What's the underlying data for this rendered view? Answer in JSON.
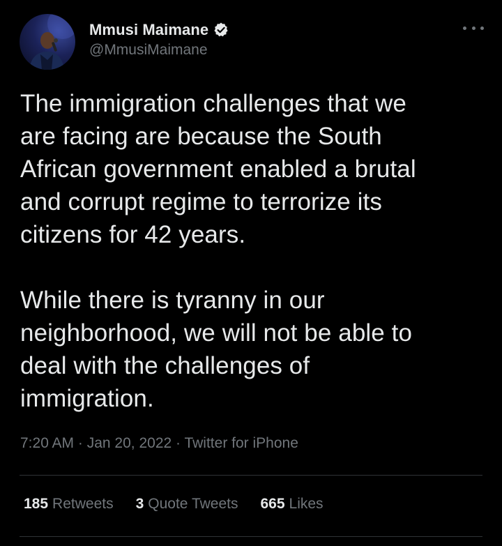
{
  "author": {
    "display_name": "Mmusi Maimane",
    "handle": "@MmusiMaimane",
    "verified": true,
    "avatar_icon": "profile-photo-speaker-with-microphone"
  },
  "tweet": {
    "text": "The immigration challenges that we\nare facing are because the South\nAfrican government enabled a brutal\nand corrupt regime to terrorize its\ncitizens for 42 years.\n\nWhile there is tyranny in our\nneighborhood, we will not be able to\ndeal with the challenges of\nimmigration.",
    "time": "7:20 AM",
    "date": "Jan 20, 2022",
    "source": "Twitter for iPhone",
    "separator": "·"
  },
  "stats": [
    {
      "count": "185",
      "label": "Retweets"
    },
    {
      "count": "3",
      "label": "Quote Tweets"
    },
    {
      "count": "665",
      "label": "Likes"
    }
  ],
  "colors": {
    "background": "#000000",
    "primary_text": "#e7e9ea",
    "secondary_text": "#71767b",
    "divider": "#2f3336",
    "verified_badge": "#e7e9ea"
  }
}
